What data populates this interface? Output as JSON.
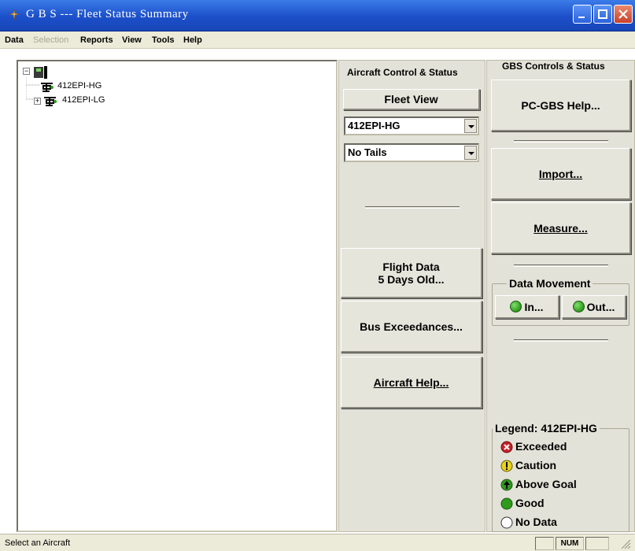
{
  "window": {
    "title": "G B S --- Fleet Status Summary",
    "icon": "gbs-app-icon"
  },
  "menu": {
    "items": [
      {
        "label": "Data",
        "enabled": true
      },
      {
        "label": "Selection",
        "enabled": false
      },
      {
        "label": "Reports",
        "enabled": true
      },
      {
        "label": "View",
        "enabled": true
      },
      {
        "label": "Tools",
        "enabled": true
      },
      {
        "label": "Help",
        "enabled": true
      }
    ]
  },
  "tree": {
    "root_expander": "⊟",
    "items": [
      {
        "label": "412EPI-HG",
        "expander": ""
      },
      {
        "label": "412EPI-LG",
        "expander": "+"
      }
    ]
  },
  "aircraft_panel": {
    "title": "Aircraft Control & Status",
    "fleet_view_label": "Fleet View",
    "aircraft_select_value": "412EPI-HG",
    "tails_select_value": "No Tails",
    "flight_data_line1": "Flight Data",
    "flight_data_line2": "5 Days Old...",
    "bus_exceedances_label": "Bus Exceedances...",
    "aircraft_help_label": "Aircraft Help..."
  },
  "gbs_panel": {
    "title": "GBS Controls & Status",
    "help_label": "PC-GBS Help...",
    "import_label": "Import...",
    "measure_label": "Measure...",
    "data_movement_title": "Data Movement",
    "in_label": "In...",
    "out_label": "Out..."
  },
  "legend": {
    "title": "Legend: 412EPI-HG",
    "items": [
      {
        "label": "Exceeded",
        "icon": "x-circle-icon",
        "color": "#c8202a"
      },
      {
        "label": "Caution",
        "icon": "exclamation-circle-icon",
        "color": "#e8d21c"
      },
      {
        "label": "Above Goal",
        "icon": "arrow-up-circle-icon",
        "color": "#2f9a1e"
      },
      {
        "label": "Good",
        "icon": "green-circle-icon",
        "color": "#2f9a1e"
      },
      {
        "label": "No Data",
        "icon": "empty-circle-icon",
        "color": "#ffffff"
      }
    ]
  },
  "status": {
    "text": "Select an Aircraft",
    "num_indicator": "NUM"
  }
}
